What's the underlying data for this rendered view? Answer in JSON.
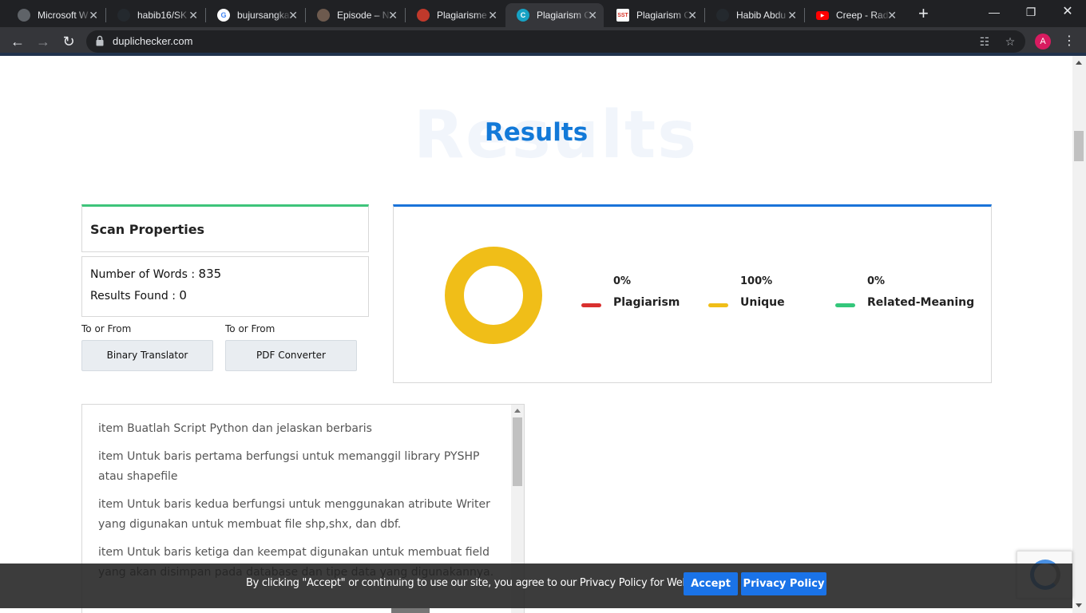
{
  "browser": {
    "tabs": [
      {
        "title": "Microsoft W",
        "icon": "globe-icon",
        "color": "#5f6368"
      },
      {
        "title": "habib16/SK",
        "icon": "github-icon",
        "color": "#24292e"
      },
      {
        "title": "bujursangka",
        "icon": "google-icon",
        "color": "#ffffff"
      },
      {
        "title": "Episode – N",
        "icon": "anime-icon",
        "color": "#6d5a4e"
      },
      {
        "title": "Plagiarisme",
        "icon": "plagiarism-app-icon",
        "color": "#c0392b"
      },
      {
        "title": "Plagiarism C",
        "icon": "duplichecker-icon",
        "color": "#17a2c4",
        "active": true
      },
      {
        "title": "Plagiarism C",
        "icon": "sst-icon",
        "color": "#ffffff"
      },
      {
        "title": "Habib Abdu",
        "icon": "github-icon",
        "color": "#24292e"
      },
      {
        "title": "Creep - Rad",
        "icon": "youtube-icon",
        "color": "#ff0000"
      }
    ],
    "url": "duplichecker.com",
    "avatar_letter": "A"
  },
  "page": {
    "hero_title": "Results",
    "hero_bg": "Results",
    "scan_properties": {
      "title": "Scan Properties",
      "words_label": "Number of Words : ",
      "words_value": "835",
      "results_label": "Results Found : ",
      "results_value": "0"
    },
    "tools": [
      {
        "caption": "To or From",
        "button": "Binary Translator"
      },
      {
        "caption": "To or From",
        "button": "PDF Converter"
      }
    ],
    "text_content": [
      "item Buatlah Script Python dan jelaskan berbaris",
      "item Untuk baris pertama berfungsi untuk memanggil library PYSHP atau shapefile",
      "item Untuk baris kedua berfungsi untuk menggunakan atribute Writer yang digunakan untuk membuat file shp,shx, dan dbf.",
      "item Untuk baris ketiga dan keempat digunakan untuk membuat field yang akan disimpan pada database dan tipe data yang digunakannya."
    ]
  },
  "chart_data": {
    "type": "pie",
    "categories": [
      "Plagiarism",
      "Unique",
      "Related-Meaning"
    ],
    "values": [
      0,
      100,
      0
    ],
    "labels": [
      "0%",
      "100%",
      "0%"
    ],
    "colors": [
      "#d9302f",
      "#f0be18",
      "#34c77b"
    ]
  },
  "cookie": {
    "message": "By clicking \"Accept\" or continuing to use our site, you agree to our Privacy Policy for Website",
    "accept": "Accept",
    "privacy": "Privacy Policy"
  }
}
